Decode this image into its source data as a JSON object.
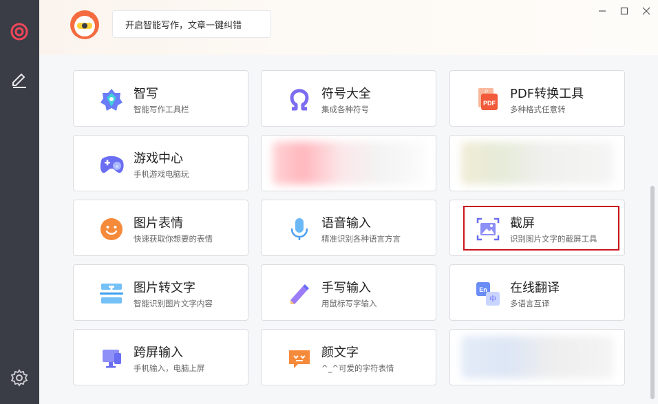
{
  "header": {
    "bubble_text": "开启智能写作，文章一键纠错"
  },
  "sidebar": {
    "items": [
      {
        "icon": "target-icon"
      },
      {
        "icon": "pen-edit-icon"
      },
      {
        "icon": "gear-icon"
      }
    ]
  },
  "cards": [
    {
      "title": "智写",
      "sub": "智能写作工具栏",
      "icon": "smart-write-icon"
    },
    {
      "title": "符号大全",
      "sub": "集成各种符号",
      "icon": "omega-icon"
    },
    {
      "title": "PDF转换工具",
      "sub": "多种格式任意转",
      "icon": "pdf-icon"
    },
    {
      "title": "游戏中心",
      "sub": "手机游戏电脑玩",
      "icon": "gamepad-icon"
    },
    {
      "title": "",
      "sub": "",
      "icon": "blurred"
    },
    {
      "title": "",
      "sub": "",
      "icon": "blurred"
    },
    {
      "title": "图片表情",
      "sub": "快速获取你想要的表情",
      "icon": "emoji-icon"
    },
    {
      "title": "语音输入",
      "sub": "精准识别各种语言方言",
      "icon": "microphone-icon"
    },
    {
      "title": "截屏",
      "sub": "识别图片文字的截屏工具",
      "icon": "screenshot-icon"
    },
    {
      "title": "图片转文字",
      "sub": "智能识别图片文字内容",
      "icon": "ocr-icon"
    },
    {
      "title": "手写输入",
      "sub": "用鼠标写字输入",
      "icon": "handwrite-icon"
    },
    {
      "title": "在线翻译",
      "sub": "多语言互译",
      "icon": "translate-icon"
    },
    {
      "title": "跨屏输入",
      "sub": "手机输入，电脑上屏",
      "icon": "cross-screen-icon"
    },
    {
      "title": "颜文字",
      "sub": "^_^可爱的字符表情",
      "icon": "kaomoji-icon"
    },
    {
      "title": "",
      "sub": "",
      "icon": "blurred"
    }
  ],
  "colors": {
    "sidebar_bg": "#3a3d46",
    "accent_red": "#c8141a",
    "brand_orange": "#f36b3f"
  }
}
